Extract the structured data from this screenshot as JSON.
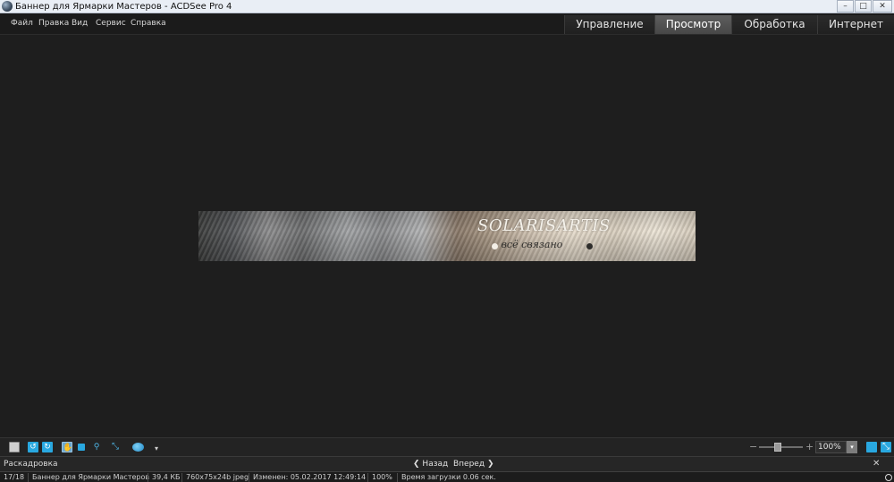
{
  "window": {
    "title": "Баннер для Ярмарки Мастеров - ACDSee Pro 4",
    "minimize_glyph": "–",
    "maximize_glyph": "□",
    "close_glyph": "✕"
  },
  "menu": {
    "items": [
      {
        "id": "file",
        "label": "Файл"
      },
      {
        "id": "edit",
        "label": "Правка"
      },
      {
        "id": "view",
        "label": "Вид"
      },
      {
        "id": "service",
        "label": "Сервис"
      },
      {
        "id": "help",
        "label": "Справка"
      }
    ]
  },
  "mode_tabs": {
    "active": "view",
    "items": [
      {
        "id": "manage",
        "label": "Управление"
      },
      {
        "id": "view",
        "label": "Просмотр"
      },
      {
        "id": "process",
        "label": "Обработка"
      },
      {
        "id": "online",
        "label": "Интернет"
      }
    ]
  },
  "image": {
    "title": "SOLARISARTIS",
    "subtitle": "всё связано"
  },
  "toolbar": {
    "icons": [
      "filmstrip-icon",
      "rotate-left-icon",
      "rotate-right-icon",
      "hand-pan-icon",
      "select-icon",
      "zoom-tool-icon",
      "fit-icon",
      "share-icon",
      "more-icon"
    ],
    "zoom_minus": "−",
    "zoom_plus": "+",
    "zoom_value": "100%",
    "zoom_dropdown_glyph": "▾",
    "colors": {
      "accent_blue": "#29a8e0"
    }
  },
  "filmstrip": {
    "label": "Раскадровка",
    "back_label": "Назад",
    "forward_label": "Вперед",
    "close_glyph": "✕"
  },
  "status": {
    "position": "17/18",
    "filename": "Баннер для Ярмарки Мастеров",
    "size": "39,4 КБ",
    "dimensions": "760x75x24b jpeg",
    "modified": "Изменен: 05.02.2017 12:49:14",
    "zoom": "100%",
    "load_time": "Время загрузки 0.06 сек."
  }
}
